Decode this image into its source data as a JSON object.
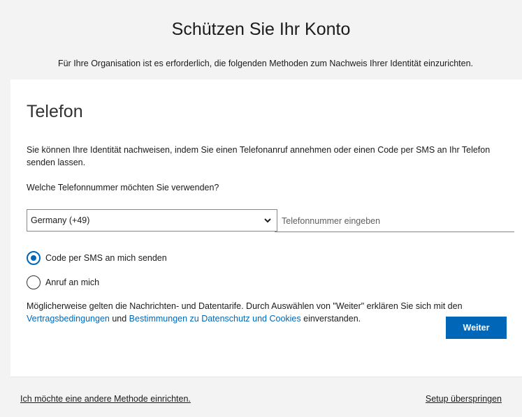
{
  "header": {
    "title": "Schützen Sie Ihr Konto",
    "subtitle": "Für Ihre Organisation ist es erforderlich, die folgenden Methoden zum Nachweis Ihrer Identität einzurichten."
  },
  "card": {
    "section_title": "Telefon",
    "description": "Sie können Ihre Identität nachweisen, indem Sie einen Telefonanruf annehmen oder einen Code per SMS an Ihr Telefon senden lassen.",
    "question": "Welche Telefonnummer möchten Sie verwenden?",
    "country_select": {
      "selected": "Germany (+49)"
    },
    "phone_input": {
      "placeholder": "Telefonnummer eingeben",
      "value": ""
    },
    "options": [
      {
        "label": "Code per SMS an mich senden",
        "selected": true
      },
      {
        "label": "Anruf an mich",
        "selected": false
      }
    ],
    "terms": {
      "text_before": "Möglicherweise gelten die Nachrichten- und Datentarife. Durch Auswählen von \"Weiter\" erklären Sie sich mit den ",
      "link_terms": "Vertragsbedingungen",
      "text_middle": " und ",
      "link_privacy": "Bestimmungen zu Datenschutz und Cookies",
      "text_after": " einverstanden."
    },
    "next_label": "Weiter"
  },
  "footer": {
    "other_method": "Ich möchte eine andere Methode einrichten.",
    "skip": "Setup überspringen"
  },
  "colors": {
    "accent": "#0067b8",
    "background": "#f3f3f3",
    "card": "#ffffff"
  },
  "icons": {
    "select_chevron": "chevron-down-icon"
  }
}
